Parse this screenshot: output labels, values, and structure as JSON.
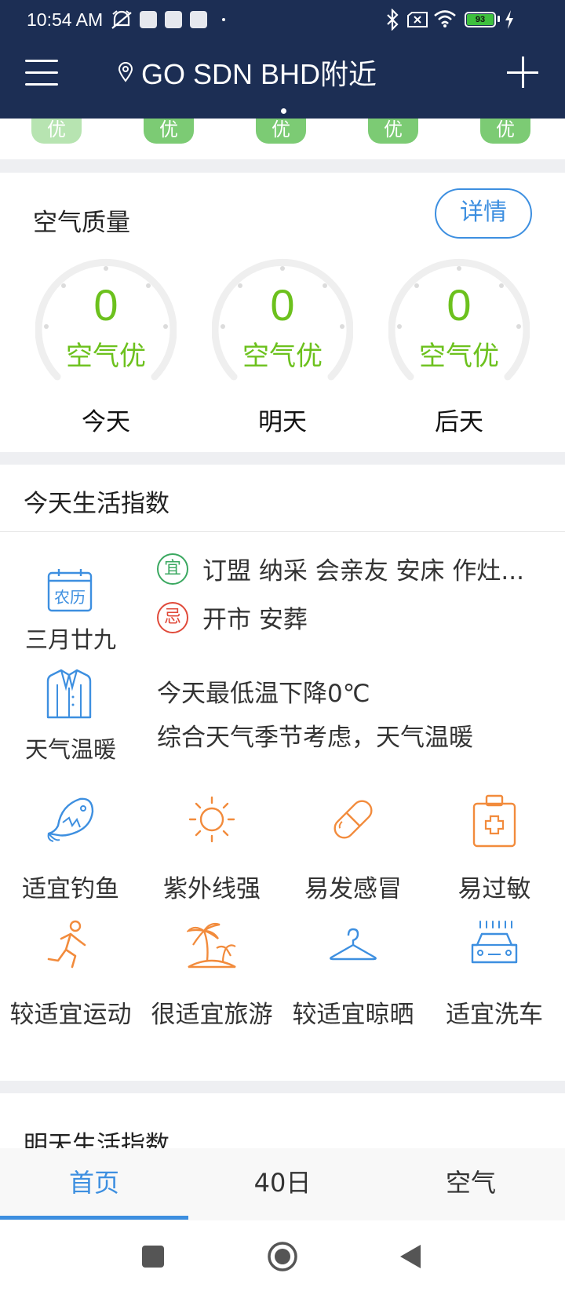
{
  "status_bar": {
    "time": "10:54 AM",
    "battery": "93",
    "icons": [
      "mute-alarm-icon",
      "notification-icon",
      "bluetooth-icon",
      "sim-icon",
      "wifi-icon",
      "battery-icon",
      "charging-icon"
    ]
  },
  "header": {
    "location": "GO SDN BHD附近",
    "colors": {
      "background": "#1c2e54"
    }
  },
  "forecast_strip": {
    "labels": [
      "优",
      "优",
      "优",
      "优",
      "优"
    ]
  },
  "air_quality": {
    "title": "空气质量",
    "detail_button": "详情",
    "days": [
      {
        "value": "0",
        "level": "空气优",
        "day": "今天"
      },
      {
        "value": "0",
        "level": "空气优",
        "day": "明天"
      },
      {
        "value": "0",
        "level": "空气优",
        "day": "后天"
      }
    ],
    "colors": {
      "good": "#6cc11d"
    }
  },
  "life_index": {
    "title": "今天生活指数",
    "lunar": {
      "icon_text": "农历",
      "date": "三月廿九",
      "yi_badge": "宜",
      "yi": "订盟 纳采 会亲友 安床 作灶...",
      "ji_badge": "忌",
      "ji": "开市 安葬"
    },
    "weather": {
      "label": "天气温暖",
      "line1": "今天最低温下降0℃",
      "line2": "综合天气季节考虑，天气温暖"
    },
    "items": [
      {
        "icon": "fish-icon",
        "label": "适宜钓鱼"
      },
      {
        "icon": "sun-icon",
        "label": "紫外线强"
      },
      {
        "icon": "pill-icon",
        "label": "易发感冒"
      },
      {
        "icon": "medkit-icon",
        "label": "易过敏"
      },
      {
        "icon": "runner-icon",
        "label": "较适宜运动"
      },
      {
        "icon": "palm-island-icon",
        "label": "很适宜旅游"
      },
      {
        "icon": "hanger-icon",
        "label": "较适宜晾晒"
      },
      {
        "icon": "car-wash-icon",
        "label": "适宜洗车"
      }
    ]
  },
  "next_section": {
    "title": "明天生活指数"
  },
  "tabs": [
    {
      "label": "首页",
      "active": true
    },
    {
      "label": "40日",
      "active": false
    },
    {
      "label": "空气",
      "active": false
    }
  ],
  "accent_color": "#3d8fe0"
}
